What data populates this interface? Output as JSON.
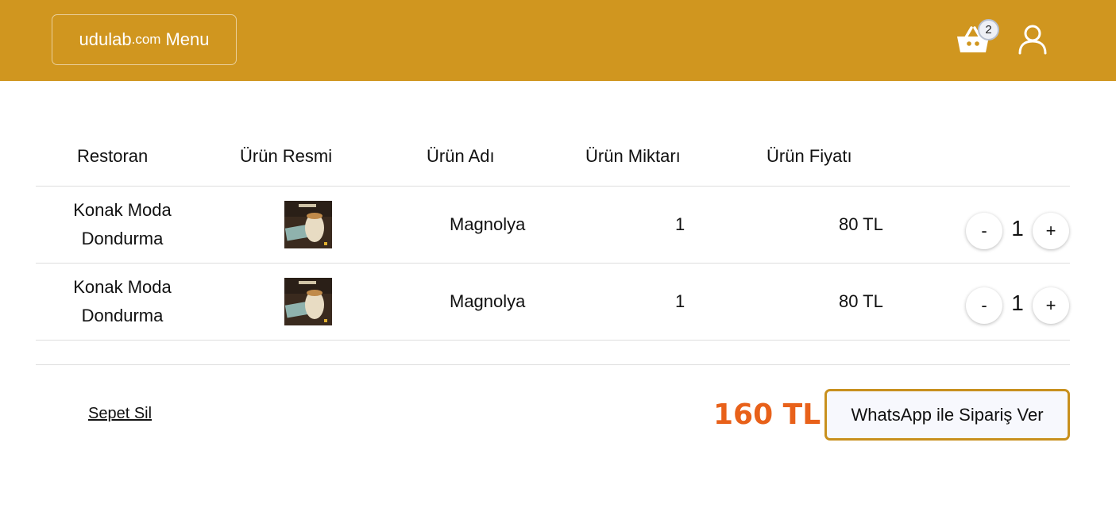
{
  "brand": {
    "name": "udulab",
    "domain": ".com",
    "suffix": "Menu"
  },
  "header": {
    "cart_icon": "shopping-basket-icon",
    "cart_count": "2",
    "user_icon": "user-icon"
  },
  "table": {
    "headers": [
      "Restoran",
      "Ürün Resmi",
      "Ürün Adı",
      "Ürün Miktarı",
      "Ürün Fiyatı"
    ],
    "rows": [
      {
        "restaurant": "Konak Moda Dondurma",
        "image_icon": "product-thumbnail",
        "product": "Magnolya",
        "quantity": "1",
        "price": "80 TL",
        "decrement": "-",
        "stepper_value": "1",
        "increment": "+"
      },
      {
        "restaurant": "Konak Moda Dondurma",
        "image_icon": "product-thumbnail",
        "product": "Magnolya",
        "quantity": "1",
        "price": "80 TL",
        "decrement": "-",
        "stepper_value": "1",
        "increment": "+"
      }
    ]
  },
  "footer": {
    "clear_label": "Sepet Sil",
    "total": "160 TL",
    "whatsapp_label": "WhatsApp ile Sipariş Ver"
  },
  "colors": {
    "navbar": "#d0961f",
    "total": "#e8611a",
    "button_border": "#c8901e"
  }
}
